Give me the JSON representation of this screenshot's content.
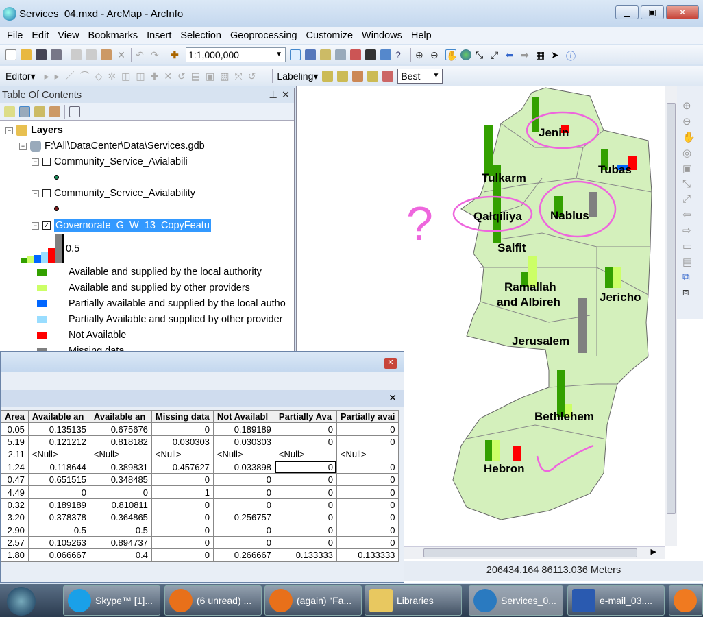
{
  "window": {
    "title": "Services_04.mxd - ArcMap - ArcInfo"
  },
  "menu": [
    "File",
    "Edit",
    "View",
    "Bookmarks",
    "Insert",
    "Selection",
    "Geoprocessing",
    "Customize",
    "Windows",
    "Help"
  ],
  "toolbar": {
    "scale": "1:1,000,000",
    "editor": "Editor",
    "labeling": "Labeling",
    "label_mode": "Best"
  },
  "toc": {
    "title": "Table Of Contents",
    "root": "Layers",
    "gdb": "F:\\All\\DataCenter\\Data\\Services.gdb",
    "layers": [
      {
        "name": "Community_Service_Avialabili",
        "checked": false,
        "symbol_color": "#1a8a5a"
      },
      {
        "name": "Community_Service_Avialability",
        "checked": false,
        "symbol_color": "#7a1a1a"
      },
      {
        "name": "Governorate_G_W_13_CopyFeatu",
        "checked": true
      }
    ],
    "chart_scale_label": "0.5",
    "legend": [
      {
        "label": "Available and supplied by the local authority",
        "color": "#33a000"
      },
      {
        "label": "Available and supplied by other providers",
        "color": "#ccff66"
      },
      {
        "label": "Partially available and supplied by the local autho",
        "color": "#0066ff"
      },
      {
        "label": "Partially Available and supplied by other provider",
        "color": "#99ddff"
      },
      {
        "label": "Not Available",
        "color": "#ff0000"
      },
      {
        "label": "Missing data",
        "color": "#808080"
      }
    ]
  },
  "map": {
    "labels": [
      "Jenin",
      "Tubas",
      "Tulkarm",
      "Qalqiliya",
      "Nablus",
      "Salfit",
      "Ramallah",
      "and Albireh",
      "Jericho",
      "Jerusalem",
      "Bethlehem",
      "Hebron"
    ],
    "annotation_mark": "?",
    "status": "206434.164  86113.036 Meters",
    "fill": "#d4f0bc"
  },
  "table": {
    "columns": [
      "Area",
      "Available an",
      "Available an",
      "Missing data",
      "Not Availabl",
      "Partially Ava",
      "Partially avai"
    ],
    "rows": [
      [
        "0.05",
        "0.135135",
        "0.675676",
        "0",
        "0.189189",
        "0",
        "0"
      ],
      [
        "5.19",
        "0.121212",
        "0.818182",
        "0.030303",
        "0.030303",
        "0",
        "0"
      ],
      [
        "2.11",
        "<Null>",
        "<Null>",
        "<Null>",
        "<Null>",
        "<Null>",
        "<Null>"
      ],
      [
        "1.24",
        "0.118644",
        "0.389831",
        "0.457627",
        "0.033898",
        "0",
        "0"
      ],
      [
        "0.47",
        "0.651515",
        "0.348485",
        "0",
        "0",
        "0",
        "0"
      ],
      [
        "4.49",
        "0",
        "0",
        "1",
        "0",
        "0",
        "0"
      ],
      [
        "0.32",
        "0.189189",
        "0.810811",
        "0",
        "0",
        "0",
        "0"
      ],
      [
        "3.20",
        "0.378378",
        "0.364865",
        "0",
        "0.256757",
        "0",
        "0"
      ],
      [
        "2.90",
        "0.5",
        "0.5",
        "0",
        "0",
        "0",
        "0"
      ],
      [
        "2.57",
        "0.105263",
        "0.894737",
        "0",
        "0",
        "0",
        "0"
      ],
      [
        "1.80",
        "0.066667",
        "0.4",
        "0",
        "0.266667",
        "0.133333",
        "0.133333"
      ]
    ]
  },
  "taskbar": [
    {
      "label": "Skype™ [1]...",
      "color": "#1aa0e8"
    },
    {
      "label": "(6 unread) ...",
      "color": "#e8701a"
    },
    {
      "label": "(again) “Fa...",
      "color": "#e8701a"
    },
    {
      "label": "Libraries",
      "color": "#e8c860"
    },
    {
      "label": "Services_0...",
      "color": "#2a7ac0"
    },
    {
      "label": "e-mail_03....",
      "color": "#2a5ab0"
    }
  ]
}
